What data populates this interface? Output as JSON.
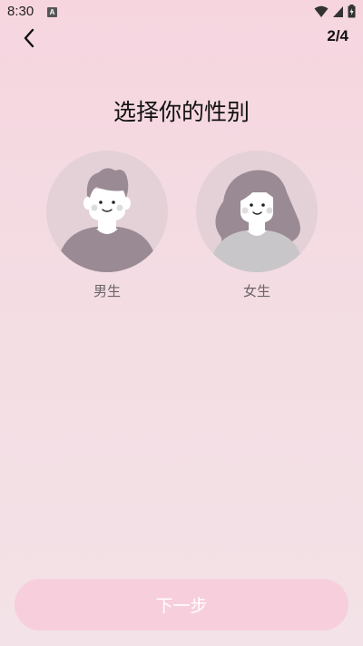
{
  "status_bar": {
    "time": "8:30",
    "notification_badge": "A",
    "icons": [
      "wifi-icon",
      "signal-icon",
      "battery-icon"
    ]
  },
  "header": {
    "back_icon": "chevron-left-icon",
    "step": "2/4"
  },
  "main": {
    "title": "选择你的性别",
    "options": [
      {
        "label": "男生",
        "icon": "male-avatar-icon"
      },
      {
        "label": "女生",
        "icon": "female-avatar-icon"
      }
    ]
  },
  "footer": {
    "next_label": "下一步"
  },
  "colors": {
    "background_top": "#f6d5df",
    "background_bottom": "#f3e2e7",
    "avatar_bg": "#e4d1d8",
    "avatar_dark": "#9a8a93",
    "avatar_light": "#c8c6c9",
    "button_bg": "#f7cfdc"
  }
}
